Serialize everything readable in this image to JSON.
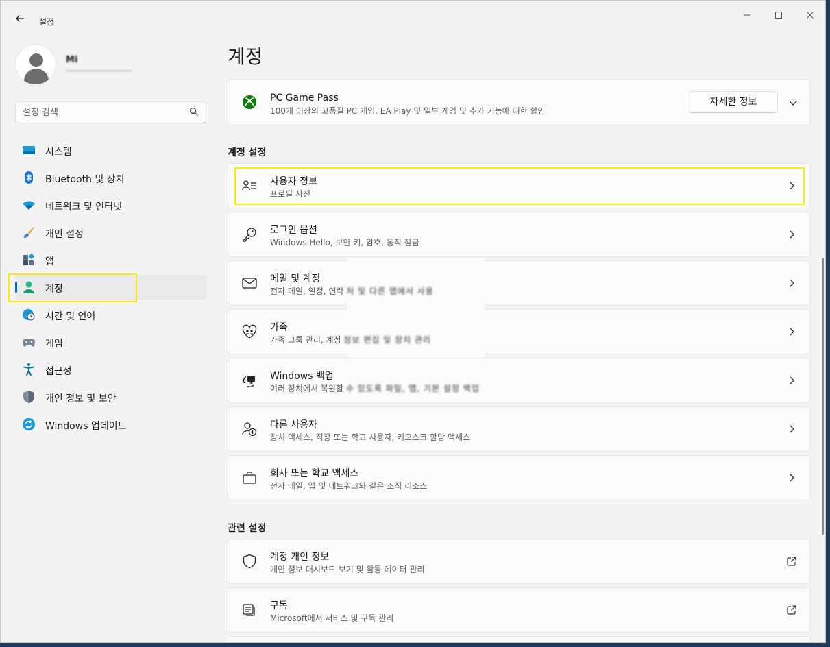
{
  "window": {
    "title": "설정",
    "controls": {
      "minimize": "—",
      "maximize": "☐",
      "close": "✕"
    }
  },
  "profile": {
    "name": "Mi",
    "email": "································"
  },
  "search": {
    "placeholder": "설정 검색",
    "value": ""
  },
  "sidebar": {
    "items": [
      {
        "label": "시스템",
        "icon": "system-icon"
      },
      {
        "label": "Bluetooth 및 장치",
        "icon": "bluetooth-icon"
      },
      {
        "label": "네트워크 및 인터넷",
        "icon": "wifi-icon"
      },
      {
        "label": "개인 설정",
        "icon": "brush-icon"
      },
      {
        "label": "앱",
        "icon": "apps-icon"
      },
      {
        "label": "계정",
        "icon": "account-icon",
        "selected": true
      },
      {
        "label": "시간 및 언어",
        "icon": "globe-clock-icon"
      },
      {
        "label": "게임",
        "icon": "gamepad-icon"
      },
      {
        "label": "접근성",
        "icon": "accessibility-icon"
      },
      {
        "label": "개인 정보 및 보안",
        "icon": "shield-icon"
      },
      {
        "label": "Windows 업데이트",
        "icon": "update-icon"
      }
    ]
  },
  "main": {
    "title": "계정",
    "game_pass": {
      "title": "PC Game Pass",
      "subtitle": "100개 이상의 고품질 PC 게임, EA Play 및 일부 게임 및 추가 기능에 대한 할인",
      "button": "자세한 정보"
    },
    "account_settings_label": "계정 설정",
    "account_settings": [
      {
        "title": "사용자 정보",
        "subtitle": "프로필 사진",
        "icon": "user-info-icon"
      },
      {
        "title": "로그인 옵션",
        "subtitle": "Windows Hello, 보안 키, 암호, 동적 잠금",
        "icon": "key-icon"
      },
      {
        "title": "메일 및 계정",
        "subtitle": "전자 메일, 일정, 연락",
        "subtitle_hidden": "처 및 다른 앱에서 사용",
        "icon": "mail-icon"
      },
      {
        "title": "가족",
        "subtitle": "가족 그룹 관리, 계정",
        "subtitle_hidden": "정보 편집 및 장치 관리",
        "icon": "family-heart-icon"
      },
      {
        "title": "Windows 백업",
        "subtitle": "여러 장치에서 복원할",
        "subtitle_hidden": "수 있도록 파일, 앱, 기본 설정 백업",
        "icon": "backup-icon"
      },
      {
        "title": "다른 사용자",
        "subtitle": "장치 액세스, 직장 또는 학교 사용자, 키오스크 할당 액세스",
        "icon": "add-user-icon"
      },
      {
        "title": "회사 또는 학교 액세스",
        "subtitle": "전자 메일, 앱 및 네트워크와 같은 조직 리소스",
        "icon": "briefcase-icon"
      }
    ],
    "related_label": "관련 설정",
    "related": [
      {
        "title": "계정 개인 정보",
        "subtitle": "개인 정보 대시보드 보기 및 활동 데이터 관리",
        "icon": "privacy-shield-icon"
      },
      {
        "title": "구독",
        "subtitle": "Microsoft에서 서비스 및 구독 관리",
        "icon": "subscription-icon"
      }
    ]
  },
  "colors": {
    "accent": "#0067c0",
    "highlight": "#ffeb00",
    "xbox_green": "#107c10"
  }
}
